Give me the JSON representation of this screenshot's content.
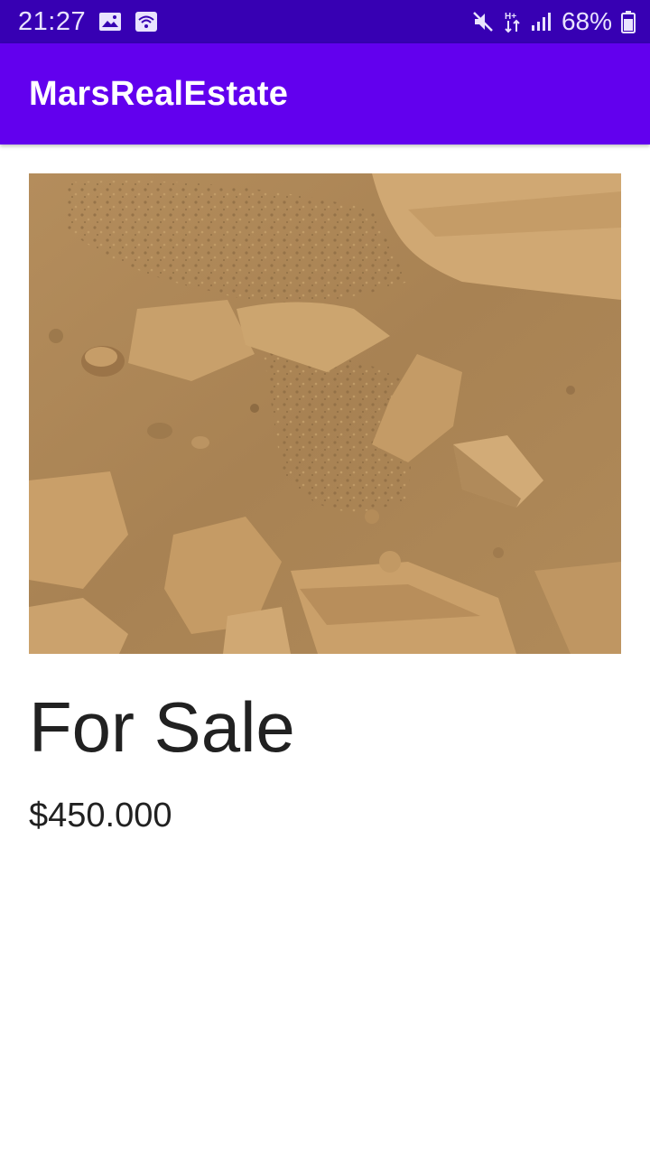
{
  "status_bar": {
    "time": "21:27",
    "battery": "68%",
    "left_icons": [
      "image-icon",
      "wifi-icon"
    ],
    "right_icons": [
      "mute-icon",
      "data-arrows-icon",
      "signal-icon",
      "battery-icon"
    ],
    "color": "#3700B3"
  },
  "app_bar": {
    "title": "MarsRealEstate",
    "color": "#6200EE"
  },
  "property": {
    "image_icon": "mars-surface-photo",
    "type_label": "For Sale",
    "price": "$450.000"
  }
}
